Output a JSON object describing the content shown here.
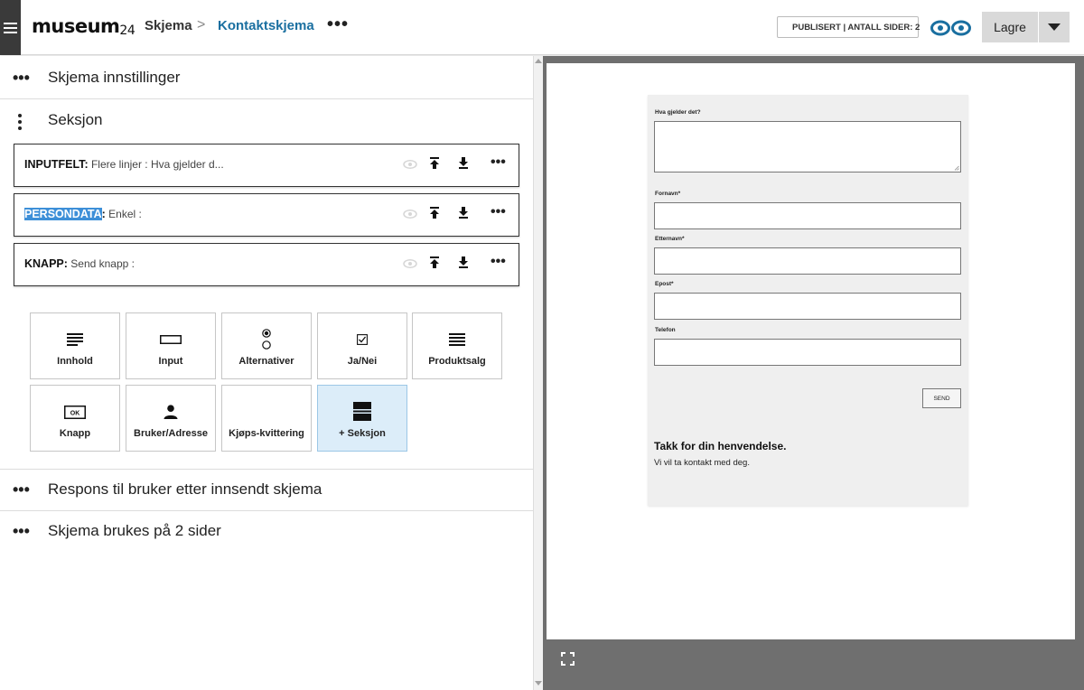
{
  "header": {
    "logo": "museum",
    "logo_suffix": "24",
    "breadcrumb": [
      "Skjema",
      "Kontaktskjema"
    ],
    "separator": ">",
    "more": "•••",
    "status": "PUBLISERT | ANTALL SIDER: 2",
    "status_color": "#2a9d3a",
    "save_label": "Lagre"
  },
  "left": {
    "settings_title": "Skjema innstillinger",
    "section_title": "Seksjon",
    "fields": [
      {
        "type": "INPUTFELT",
        "sep": ":",
        "desc": " Flere linjer : Hva gjelder d...",
        "highlighted": false
      },
      {
        "type": "PERSONDATA",
        "sep": ":",
        "desc": " Enkel :",
        "highlighted": true
      },
      {
        "type": "KNAPP",
        "sep": ":",
        "desc": " Send knapp :",
        "highlighted": false
      }
    ],
    "tiles": [
      {
        "label": "Innhold",
        "icon": "lines-icon"
      },
      {
        "label": "Input",
        "icon": "input-box-icon"
      },
      {
        "label": "Alternativer",
        "icon": "radio-icon"
      },
      {
        "label": "Ja/Nei",
        "icon": "checkbox-icon"
      },
      {
        "label": "Produktsalg",
        "icon": "lines-icon"
      },
      {
        "label": "Knapp",
        "icon": "ok-button-icon"
      },
      {
        "label": "Bruker/Adresse",
        "icon": "person-icon"
      },
      {
        "label": "Kjøps-kvittering",
        "icon": "none"
      },
      {
        "label": "+ Seksjon",
        "icon": "section-icon"
      }
    ],
    "response_title": "Respons til bruker etter innsendt skjema",
    "usage_title": "Skjema brukes på 2 sider",
    "dots": "•••"
  },
  "preview": {
    "q1_label": "Hva gjelder det?",
    "firstname_label": "Fornavn*",
    "lastname_label": "Etternavn*",
    "email_label": "Epost*",
    "phone_label": "Telefon",
    "send_label": "SEND",
    "thanks_title": "Takk for din henvendelse.",
    "thanks_text": "Vi vil ta kontakt med deg."
  },
  "colors": {
    "accent": "#1a6fa0",
    "highlight": "#3d8fd8",
    "active_tile": "#dcedf9"
  }
}
